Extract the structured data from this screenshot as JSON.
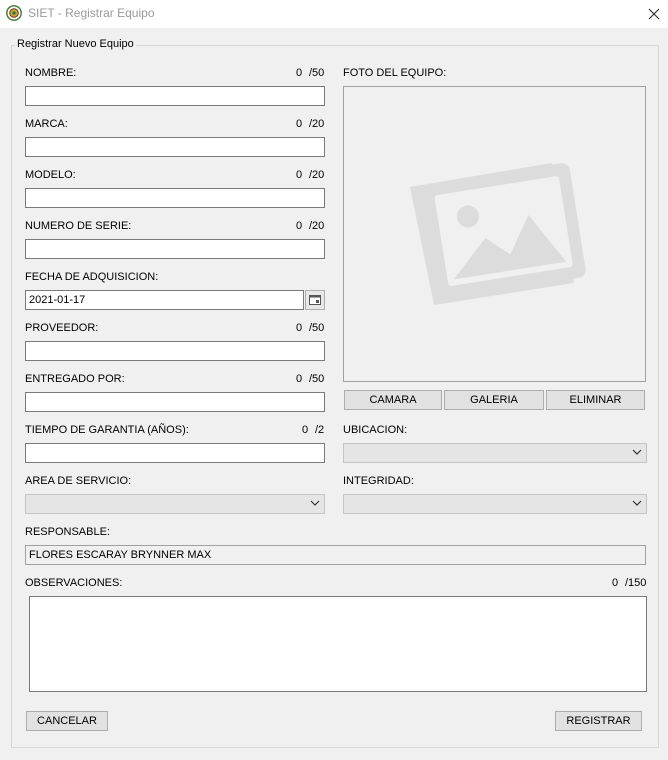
{
  "window": {
    "title": "SIET - Registrar Equipo",
    "close_icon": "close-icon"
  },
  "group": {
    "title": "Registrar Nuevo Equipo"
  },
  "fields": {
    "nombre": {
      "label": "NOMBRE:",
      "count": "0",
      "max": "/50",
      "value": ""
    },
    "marca": {
      "label": "MARCA:",
      "count": "0",
      "max": "/20",
      "value": ""
    },
    "modelo": {
      "label": "MODELO:",
      "count": "0",
      "max": "/20",
      "value": ""
    },
    "numero_serie": {
      "label": "NUMERO DE SERIE:",
      "count": "0",
      "max": "/20",
      "value": ""
    },
    "fecha": {
      "label": "FECHA DE ADQUISICION:",
      "value": "2021-01-17"
    },
    "proveedor": {
      "label": "PROVEEDOR:",
      "count": "0",
      "max": "/50",
      "value": ""
    },
    "entregado": {
      "label": "ENTREGADO POR:",
      "count": "0",
      "max": "/50",
      "value": ""
    },
    "garantia": {
      "label": "TIEMPO DE GARANTIA (AÑOS):",
      "count": "0",
      "max": "/2",
      "value": ""
    },
    "area": {
      "label": "AREA DE SERVICIO:",
      "value": ""
    },
    "ubicacion": {
      "label": "UBICACION:",
      "value": ""
    },
    "integridad": {
      "label": "INTEGRIDAD:",
      "value": ""
    },
    "responsable": {
      "label": "RESPONSABLE:",
      "value": "FLORES ESCARAY BRYNNER MAX"
    },
    "observaciones": {
      "label": "OBSERVACIONES:",
      "count": "0",
      "max": "/150",
      "value": ""
    }
  },
  "photo": {
    "label": "FOTO DEL EQUIPO:",
    "placeholder_icon": "image-placeholder-icon",
    "buttons": {
      "camera": "CAMARA",
      "gallery": "GALERIA",
      "delete": "ELIMINAR"
    }
  },
  "actions": {
    "cancel": "CANCELAR",
    "register": "REGISTRAR"
  },
  "colors": {
    "background": "#f0f0f0",
    "placeholder_icon": "#dcdcdc"
  }
}
